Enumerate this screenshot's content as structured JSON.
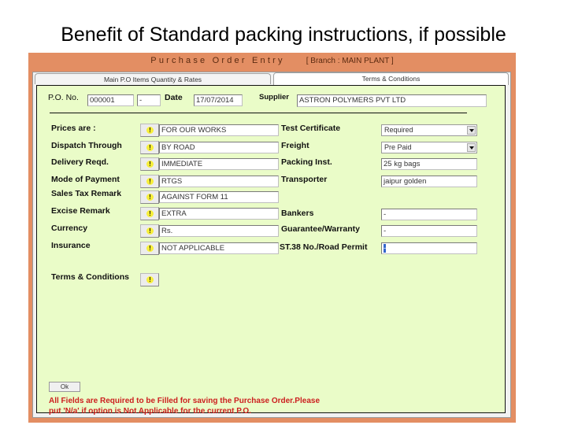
{
  "slide": {
    "title": "Benefit of Standard packing instructions, if possible"
  },
  "window": {
    "title": "Purchase Order Entry",
    "branch": "[ Branch : MAIN PLANT ]",
    "colors": {
      "frame": "#e38e63",
      "panel": "#eafcc8",
      "note": "#cc1f1f",
      "warn": "#f6ee3a"
    }
  },
  "tabs": [
    {
      "label": "Main P.O Items  Quantity & Rates",
      "active": false
    },
    {
      "label": "Terms & Conditions",
      "active": true
    }
  ],
  "header": {
    "po_no_label": "P.O. No.",
    "po_no_value": "000001",
    "po_suffix_value": "-",
    "date_label": "Date",
    "date_value": "17/07/2014",
    "supplier_label": "Supplier",
    "supplier_value": "ASTRON POLYMERS PVT LTD"
  },
  "left_fields": [
    {
      "label": "Prices are :",
      "value": "FOR OUR WORKS"
    },
    {
      "label": "Dispatch Through",
      "value": "BY ROAD"
    },
    {
      "label": "Delivery Reqd.",
      "value": "IMMEDIATE"
    },
    {
      "label": "Mode of Payment",
      "value": "RTGS"
    },
    {
      "label": "Sales Tax Remark",
      "value": "AGAINST FORM 11"
    },
    {
      "label": "Excise Remark",
      "value": "EXTRA"
    },
    {
      "label": "Currency",
      "value": "Rs."
    },
    {
      "label": "Insurance",
      "value": "NOT APPLICABLE"
    }
  ],
  "right_fields": [
    {
      "label": "Test Certificate",
      "value": "Required",
      "type": "select"
    },
    {
      "label": "Freight",
      "value": "Pre Paid",
      "type": "select"
    },
    {
      "label": "Packing Inst.",
      "value": "25 kg bags",
      "type": "text"
    },
    {
      "label": "Transporter",
      "value": "jaipur golden",
      "type": "text"
    },
    {
      "label": "Bankers",
      "value": "-",
      "type": "text"
    },
    {
      "label": "Guarantee/Warranty",
      "value": "-",
      "type": "text"
    },
    {
      "label": "ST.38 No./Road Permit",
      "value": "-",
      "type": "text"
    }
  ],
  "terms_label": "Terms & Conditions",
  "ok_label": "Ok",
  "note": "All Fields are Required to be Filled for saving the Purchase Order.Please put 'N/a' if option is Not Applicable for the current P.O."
}
